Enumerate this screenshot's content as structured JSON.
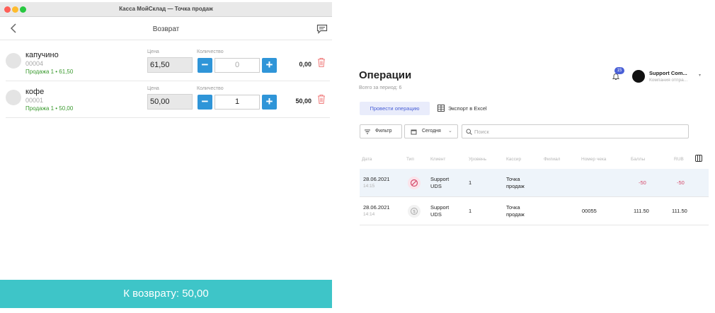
{
  "window": {
    "title": "Касса МойСклад — Точка продаж"
  },
  "nav": {
    "title": "Возврат"
  },
  "items": [
    {
      "name": "капучино",
      "code": "00004",
      "sale": "Продажа 1 • 61,50",
      "price_label": "Цена",
      "price": "61,50",
      "qty_label": "Количество",
      "qty": "0",
      "total": "0,00"
    },
    {
      "name": "кофе",
      "code": "00001",
      "sale": "Продажа 1 • 50,00",
      "price_label": "Цена",
      "price": "50,00",
      "qty_label": "Количество",
      "qty": "1",
      "total": "50,00"
    }
  ],
  "footer": {
    "label": "К возврату: 50,00"
  },
  "operations": {
    "title": "Операции",
    "subtitle": "Всего за период: 6",
    "badge": "15",
    "user_name": "Support Com...",
    "user_company": "Компания отпра...",
    "primary_button": "Провести операцию",
    "export_label": "Экспорт в Excel",
    "filter_label": "Фильтр",
    "date_label": "Сегодня",
    "search_placeholder": "Поиск",
    "headers": [
      "Дата",
      "Тип",
      "Клиент",
      "Уровень",
      "Кассир",
      "Филиал",
      "Номер чека",
      "Баллы",
      "RUB"
    ],
    "rows": [
      {
        "date": "28.06.2021",
        "time": "14:15",
        "type_icon": "cancel-icon",
        "client1": "Support",
        "client2": "UDS",
        "level": "1",
        "cashier1": "Точка",
        "cashier2": "продаж",
        "branch": "",
        "receipt": "",
        "points": "-50",
        "rub": "-50"
      },
      {
        "date": "28.06.2021",
        "time": "14:14",
        "type_icon": "coin-icon",
        "client1": "Support",
        "client2": "UDS",
        "level": "1",
        "cashier1": "Точка",
        "cashier2": "продаж",
        "branch": "",
        "receipt": "00055",
        "points": "111.50",
        "rub": "111.50"
      }
    ]
  },
  "colors": {
    "accent": "#2f95d8",
    "footer": "#3ec5c8",
    "sale_text": "#3a9a2e",
    "brand_blue": "#4a60d6",
    "negative": "#d54a6b"
  }
}
